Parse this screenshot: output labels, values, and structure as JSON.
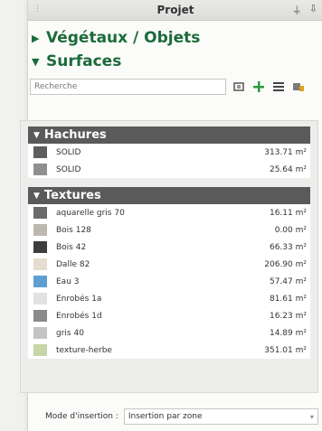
{
  "window": {
    "title": "Projet"
  },
  "sections": {
    "vegetaux": {
      "label": "Végétaux / Objets"
    },
    "surfaces": {
      "label": "Surfaces"
    }
  },
  "search": {
    "placeholder": "Recherche"
  },
  "hachures": {
    "title": "Hachures",
    "rows": [
      {
        "label": "SOLID",
        "area": "313.71 m²",
        "color": "#5e5e5e"
      },
      {
        "label": "SOLID",
        "area": "25.64 m²",
        "color": "#8f8f8f"
      }
    ]
  },
  "textures": {
    "title": "Textures",
    "rows": [
      {
        "label": "aquarelle gris 70",
        "area": "16.11 m²",
        "color": "#6b6b6b"
      },
      {
        "label": "Bois 128",
        "area": "0.00 m²",
        "color": "#bdb8ae"
      },
      {
        "label": "Bois 42",
        "area": "66.33 m²",
        "color": "#3d3d3d"
      },
      {
        "label": "Dalle 82",
        "area": "206.90 m²",
        "color": "#e4ddd0"
      },
      {
        "label": "Eau 3",
        "area": "57.47 m²",
        "color": "#5f9fd0"
      },
      {
        "label": "Enrobés 1a",
        "area": "81.61 m²",
        "color": "#e2e2e2"
      },
      {
        "label": "Enrobés 1d",
        "area": "16.23 m²",
        "color": "#8a8a8a"
      },
      {
        "label": "gris 40",
        "area": "14.89 m²",
        "color": "#c4c4c4"
      },
      {
        "label": "texture-herbe",
        "area": "351.01 m²",
        "color": "#c5d7a8"
      }
    ]
  },
  "footer": {
    "mode_label": "Mode d'insertion :",
    "mode_value": "Insertion par zone"
  },
  "colors": {
    "accent_green": "#1b6b3a",
    "group_header": "#5a5a5a"
  }
}
